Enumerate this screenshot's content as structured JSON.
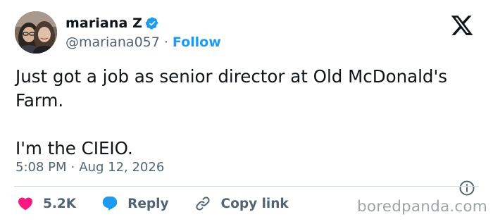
{
  "author": {
    "display_name": "mariana Z",
    "handle": "@mariana057",
    "separator": "·",
    "follow_label": "Follow"
  },
  "tweet": {
    "paragraphs": [
      "Just got a job as senior director at Old McDonald's Farm.",
      "I'm the CIEIO."
    ],
    "time": "5:08 PM",
    "date_separator": "·",
    "date": "Aug 12, 2026"
  },
  "actions": {
    "like_count": "5.2K",
    "reply_label": "Reply",
    "copy_label": "Copy link"
  },
  "watermark": "boredpanda.com",
  "colors": {
    "accent": "#1d9bf0",
    "like": "#f91880",
    "text": "#0f1419",
    "muted": "#536471",
    "divider": "#cfd9de"
  },
  "icons": [
    "verified-badge-icon",
    "x-logo-icon",
    "info-icon",
    "heart-icon",
    "reply-bubble-icon",
    "link-icon"
  ]
}
